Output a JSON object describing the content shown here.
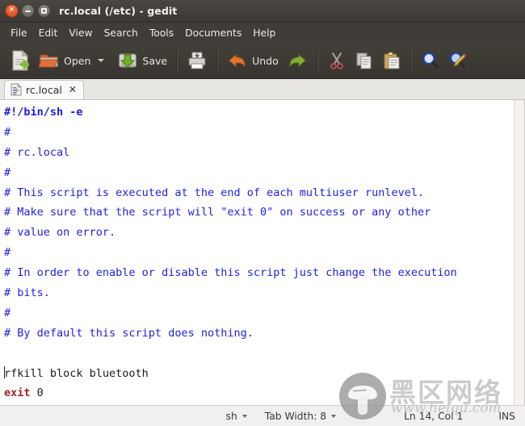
{
  "window": {
    "title": "rc.local (/etc) - gedit",
    "controls": [
      {
        "name": "close",
        "glyph": "×"
      },
      {
        "name": "minimize",
        "glyph": "−"
      },
      {
        "name": "maximize",
        "glyph": "□"
      }
    ]
  },
  "menubar": {
    "items": [
      {
        "label": "File"
      },
      {
        "label": "Edit"
      },
      {
        "label": "View"
      },
      {
        "label": "Search"
      },
      {
        "label": "Tools"
      },
      {
        "label": "Documents"
      },
      {
        "label": "Help"
      }
    ]
  },
  "toolbar": {
    "new_label": "",
    "new_icon": "new-document-icon",
    "open_label": "Open",
    "open_icon": "open-folder-icon",
    "open_dropdown_icon": "chevron-down-icon",
    "save_label": "Save",
    "save_icon": "save-disk-icon",
    "print_label": "",
    "print_icon": "printer-icon",
    "undo_label": "Undo",
    "undo_icon": "undo-arrow-icon",
    "redo_label": "",
    "redo_icon": "redo-arrow-icon",
    "cut_label": "",
    "cut_icon": "scissors-icon",
    "copy_label": "",
    "copy_icon": "copy-icon",
    "paste_label": "",
    "paste_icon": "clipboard-paste-icon",
    "find_label": "",
    "find_icon": "magnifier-icon",
    "replace_label": "",
    "replace_icon": "magnifier-pencil-icon"
  },
  "tabs": [
    {
      "label": "rc.local",
      "icon": "document-icon",
      "close_glyph": "✕",
      "active": true
    }
  ],
  "editor": {
    "filename": "rc.local",
    "lines": [
      {
        "spans": [
          {
            "text": "#!/bin/sh -e",
            "style": "shebang"
          }
        ]
      },
      {
        "spans": [
          {
            "text": "#",
            "style": "comment"
          }
        ]
      },
      {
        "spans": [
          {
            "text": "# rc.local",
            "style": "comment"
          }
        ]
      },
      {
        "spans": [
          {
            "text": "#",
            "style": "comment"
          }
        ]
      },
      {
        "spans": [
          {
            "text": "# This script is executed at the end of each multiuser runlevel.",
            "style": "comment"
          }
        ]
      },
      {
        "spans": [
          {
            "text": "# Make sure that the script will \"exit 0\" on success or any other",
            "style": "comment"
          }
        ]
      },
      {
        "spans": [
          {
            "text": "# value on error.",
            "style": "comment"
          }
        ]
      },
      {
        "spans": [
          {
            "text": "#",
            "style": "comment"
          }
        ]
      },
      {
        "spans": [
          {
            "text": "# In order to enable or disable this script just change the execution",
            "style": "comment"
          }
        ]
      },
      {
        "spans": [
          {
            "text": "# bits.",
            "style": "comment"
          }
        ]
      },
      {
        "spans": [
          {
            "text": "#",
            "style": "comment"
          }
        ]
      },
      {
        "spans": [
          {
            "text": "# By default this script does nothing.",
            "style": "comment"
          }
        ]
      },
      {
        "spans": [
          {
            "text": "",
            "style": "plain"
          }
        ]
      },
      {
        "spans": [
          {
            "text": "",
            "style": "cursor"
          },
          {
            "text": "rfkill block bluetooth",
            "style": "plain"
          }
        ]
      },
      {
        "spans": [
          {
            "text": "exit",
            "style": "kw"
          },
          {
            "text": " 0",
            "style": "plain"
          }
        ]
      }
    ]
  },
  "statusbar": {
    "language": "sh",
    "tab_width": "Tab Width: 8",
    "position": "Ln 14, Col 1",
    "insert_mode": "INS"
  },
  "watermark": {
    "brand_cn": "黑区网络",
    "url": "www.heiqu.com",
    "logo_icon": "mushroom-logo-icon"
  },
  "colors": {
    "titlebar": "#3c3935",
    "menubar": "#403d39",
    "toolbar": "#3d3a34",
    "close_button": "#e0562a",
    "comment": "#1f1fe0",
    "keyword": "#9c2626",
    "editor_bg": "#ffffff",
    "statusbar": "#f2f0ee"
  }
}
